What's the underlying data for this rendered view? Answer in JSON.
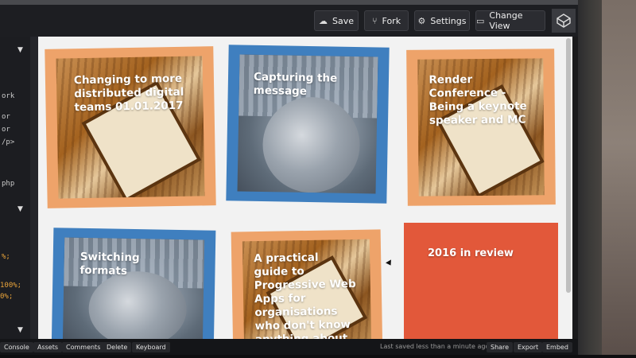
{
  "toolbar": {
    "save_label": "Save",
    "fork_label": "Fork",
    "settings_label": "Settings",
    "change_view_label": "Change View"
  },
  "editor": {
    "lines": [
      "ork",
      "or",
      "or",
      "/p>",
      "php",
      "%;",
      "100%;",
      "0%;"
    ]
  },
  "cards": [
    {
      "title": "Changing to more distributed digital teams 01.01.2017",
      "frame_color": "#eea36a",
      "image": "book"
    },
    {
      "title": "Capturing the message",
      "frame_color": "#3f7fbf",
      "image": "cat"
    },
    {
      "title": "Render Conference - Being a keynote speaker and MC",
      "frame_color": "#eea36a",
      "image": "book"
    },
    {
      "title": "Switching formats",
      "frame_color": "#3f7fbf",
      "image": "cat"
    },
    {
      "title": "A practical guide to Progressive Web Apps for organisations who don't know anything about Progressive Web",
      "frame_color": "#eea36a",
      "image": "book"
    },
    {
      "title": "2016 in review",
      "frame_color": "#e2583a",
      "image": "none"
    }
  ],
  "bottombar": {
    "console": "Console",
    "assets": "Assets",
    "comments": "Comments",
    "delete": "Delete",
    "keyboard": "Keyboard",
    "status": "Last saved less than a minute ago",
    "share": "Share",
    "export": "Export",
    "embed": "Embed"
  },
  "colors": {
    "topbar": "#1d1e22",
    "preview_bg": "#f2f2f2",
    "orange": "#eea36a",
    "blue": "#3f7fbf",
    "red": "#e2583a"
  }
}
